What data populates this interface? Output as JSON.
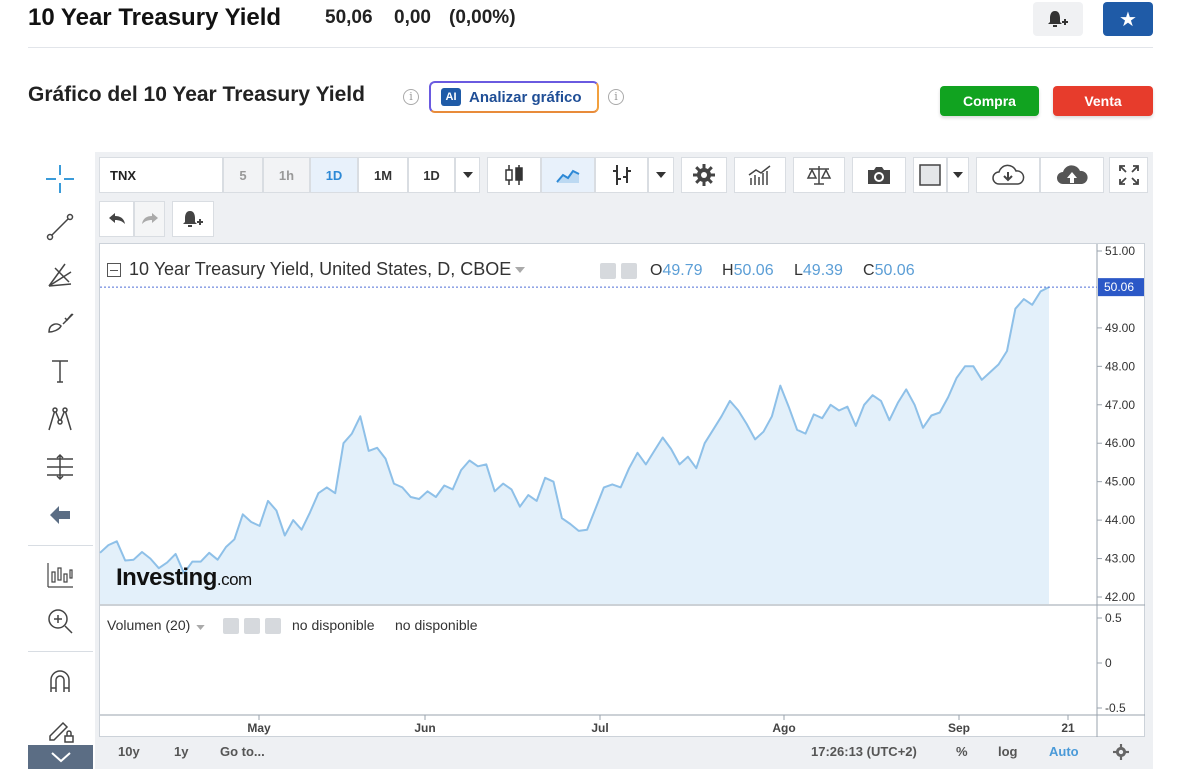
{
  "header": {
    "title": "10 Year Treasury Yield",
    "price": "50,06",
    "change": "0,00",
    "change_pct": "(0,00%)"
  },
  "section": {
    "title": "Gráfico del 10 Year Treasury Yield",
    "ai_icon": "AI",
    "ai_button": "Analizar gráfico",
    "buy_button": "Compra",
    "sell_button": "Venta"
  },
  "toolbar": {
    "symbol": "TNX",
    "intervals": [
      "5",
      "1h",
      "1D",
      "1M",
      "1D"
    ],
    "undo_icon": "undo-icon",
    "redo_icon": "redo-icon"
  },
  "legend": {
    "title": "10 Year Treasury Yield, United States, D, CBOE",
    "o_label": "O",
    "o_value": "49.79",
    "h_label": "H",
    "h_value": "50.06",
    "l_label": "L",
    "l_value": "49.39",
    "c_label": "C",
    "c_value": "50.06"
  },
  "volume": {
    "label": "Volumen (20)",
    "na1": "no disponible",
    "na2": "no disponible",
    "ticks": [
      "0.5",
      "0",
      "-0.5"
    ]
  },
  "watermark": {
    "brand": "Investing",
    "suffix": ".com"
  },
  "bottom_bar": {
    "range_10y": "10y",
    "range_1y": "1y",
    "goto": "Go to...",
    "time": "17:26:13 (UTC+2)",
    "pct": "%",
    "log": "log",
    "auto": "Auto"
  },
  "colors": {
    "line": "#8ec0e8",
    "fill": "#e3f0fa",
    "accent_blue": "#1f5ba7",
    "buy": "#11a320",
    "sell": "#e73c2c"
  },
  "chart_data": {
    "type": "area",
    "title": "10 Year Treasury Yield, United States, D, CBOE",
    "xlabel": "",
    "ylabel": "",
    "x_ticks": [
      "May",
      "Jun",
      "Jul",
      "Ago",
      "Sep",
      "21"
    ],
    "y_ticks": [
      "51.00",
      "49.00",
      "48.00",
      "47.00",
      "46.00",
      "45.00",
      "44.00",
      "43.00",
      "42.00"
    ],
    "ylim": [
      41.9,
      51.0
    ],
    "last_price_label": "50.06",
    "series": [
      {
        "values": [
          43.15,
          43.35,
          43.45,
          42.95,
          42.97,
          43.17,
          43.0,
          42.75,
          42.9,
          43.12,
          42.62,
          42.92,
          42.92,
          43.15,
          42.97,
          43.3,
          43.5,
          44.15,
          43.95,
          43.85,
          44.5,
          44.25,
          43.6,
          44.0,
          43.75,
          44.2,
          44.7,
          44.85,
          44.7,
          46.0,
          46.25,
          46.7,
          45.8,
          45.88,
          45.6,
          44.95,
          44.85,
          44.6,
          44.55,
          44.75,
          44.6,
          44.9,
          44.8,
          45.3,
          45.55,
          45.4,
          45.45,
          44.75,
          44.95,
          44.8,
          44.35,
          44.65,
          44.5,
          45.1,
          45.0,
          44.05,
          43.9,
          43.72,
          43.75,
          44.3,
          44.85,
          44.93,
          44.85,
          45.35,
          45.75,
          45.45,
          45.8,
          46.15,
          45.85,
          45.45,
          45.65,
          45.35,
          46.0,
          46.35,
          46.7,
          47.1,
          46.85,
          46.5,
          46.1,
          46.3,
          46.7,
          47.5,
          46.95,
          46.35,
          46.25,
          46.75,
          46.65,
          47.0,
          46.85,
          46.95,
          46.45,
          47.0,
          47.25,
          47.1,
          46.6,
          47.05,
          47.4,
          47.0,
          46.4,
          46.72,
          46.8,
          47.2,
          47.7,
          48.0,
          48.0,
          47.65,
          47.85,
          48.05,
          48.4,
          49.5,
          49.75,
          49.6,
          49.95,
          50.06
        ]
      }
    ]
  }
}
